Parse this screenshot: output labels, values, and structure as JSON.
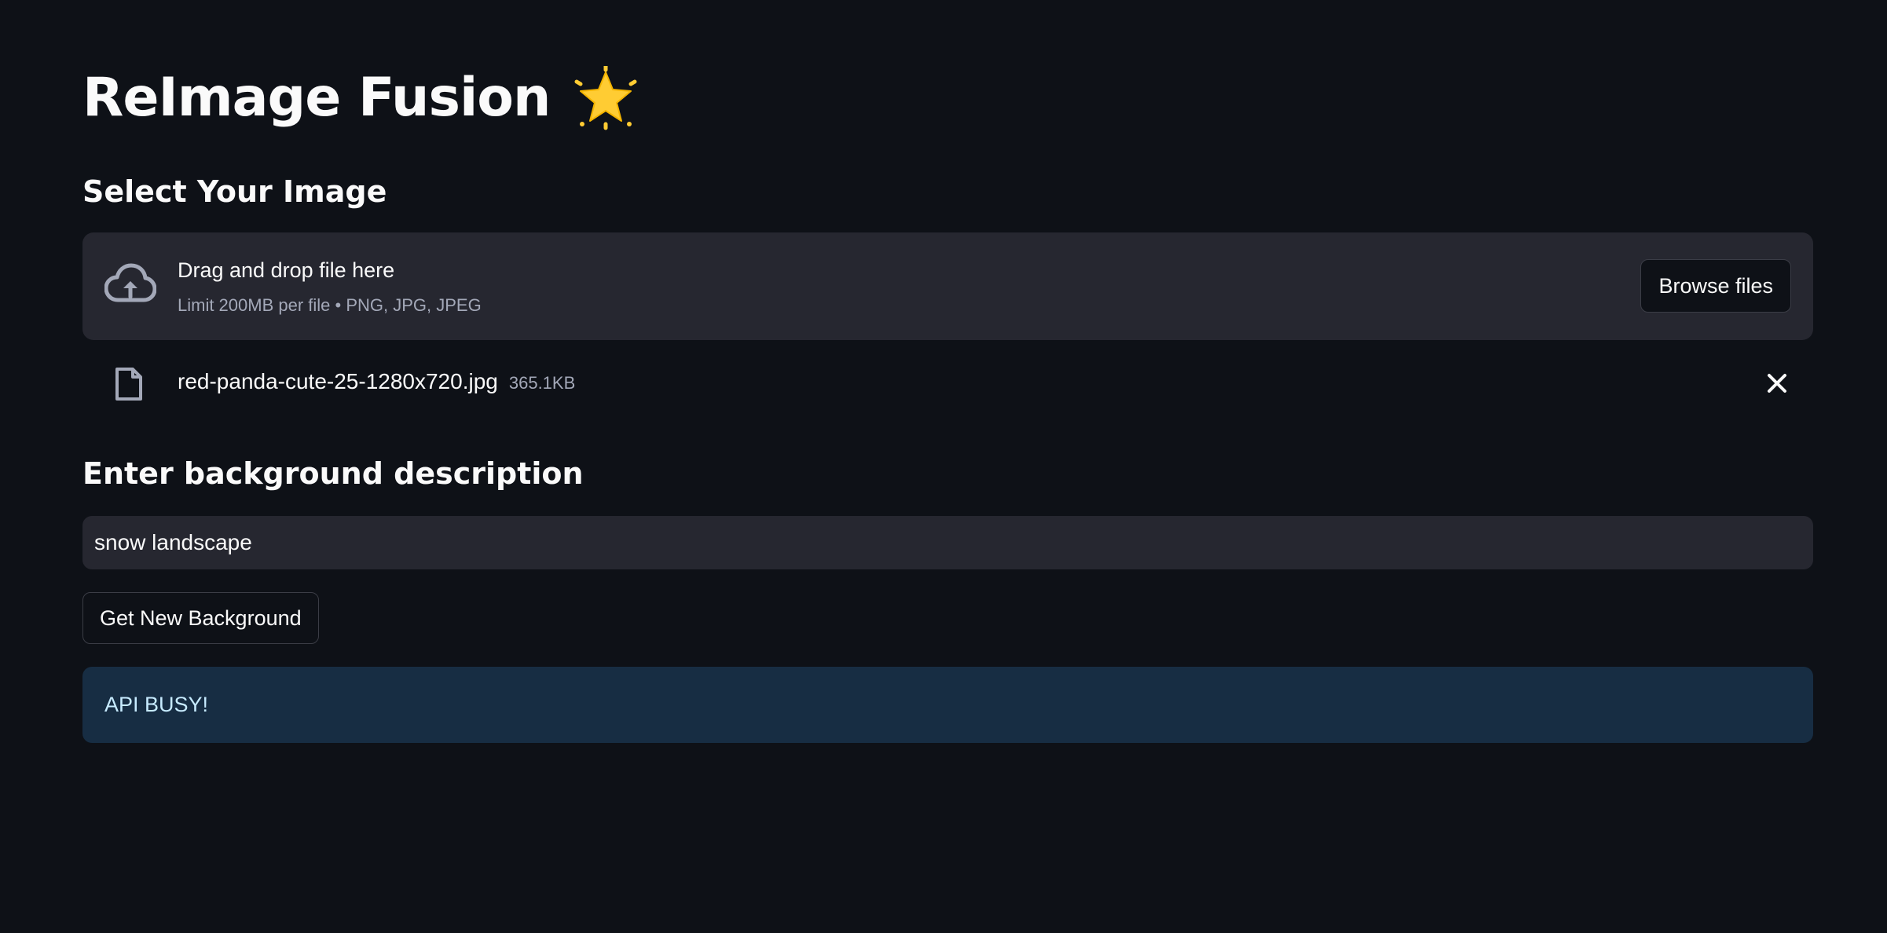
{
  "app": {
    "title": "ReImage Fusion",
    "title_icon": "glowing-star-icon"
  },
  "upload_section": {
    "heading": "Select Your Image",
    "dropzone": {
      "icon": "cloud-upload-icon",
      "primary_text": "Drag and drop file here",
      "secondary_text": "Limit 200MB per file • PNG, JPG, JPEG",
      "browse_label": "Browse files"
    },
    "uploaded_file": {
      "icon": "file-icon",
      "name": "red-panda-cute-25-1280x720.jpg",
      "size": "365.1KB",
      "remove_icon": "close-icon"
    }
  },
  "background_section": {
    "heading": "Enter background description",
    "input_value": "snow landscape",
    "button_label": "Get New Background"
  },
  "alert": {
    "message": "API BUSY!"
  },
  "colors": {
    "background": "#0e1117",
    "surface": "#262730",
    "text": "#fafafa",
    "muted_text": "#a3a8b8",
    "info_background": "#172d43",
    "info_text": "#c7ebff",
    "star": "#ffcc33"
  }
}
